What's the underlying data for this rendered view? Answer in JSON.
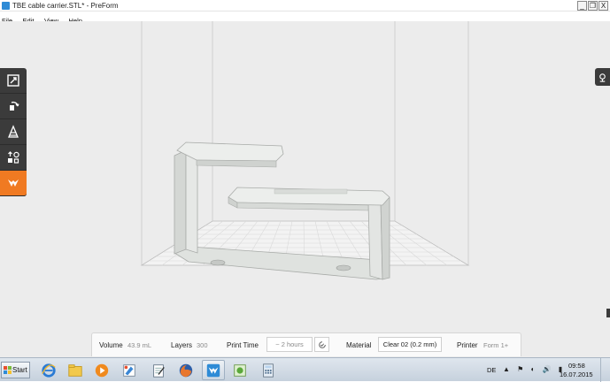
{
  "window": {
    "title": "TBE cable carrier.STL* - PreForm",
    "minimize": "_",
    "maximize": "❐",
    "close": "X"
  },
  "menu": [
    "File",
    "Edit",
    "View",
    "Help"
  ],
  "toolbar": {
    "tools": [
      "scale-tool",
      "rotate-tool",
      "orient-tool",
      "layout-tool",
      "support-tool"
    ],
    "active": "support-tool",
    "accent": "#f07a22"
  },
  "status": {
    "volume_label": "Volume",
    "volume_value": "43.9 mL",
    "layers_label": "Layers",
    "layers_value": "300",
    "print_time_label": "Print Time",
    "print_time_value": "~ 2 hours",
    "material_label": "Material",
    "material_value": "Clear 02 (0.2 mm)",
    "printer_label": "Printer",
    "printer_value": "Form 1+"
  },
  "taskbar": {
    "start_label": "Start",
    "apps": [
      "internet-explorer",
      "file-explorer",
      "media-player",
      "paint",
      "notepad",
      "firefox",
      "preform",
      "greenshot",
      "calculator"
    ],
    "active_app": "preform",
    "language": "DE",
    "tray": "▲ ⚑ ◐ 🔊 ▮",
    "time": "09:58",
    "date": "16.07.2015"
  }
}
